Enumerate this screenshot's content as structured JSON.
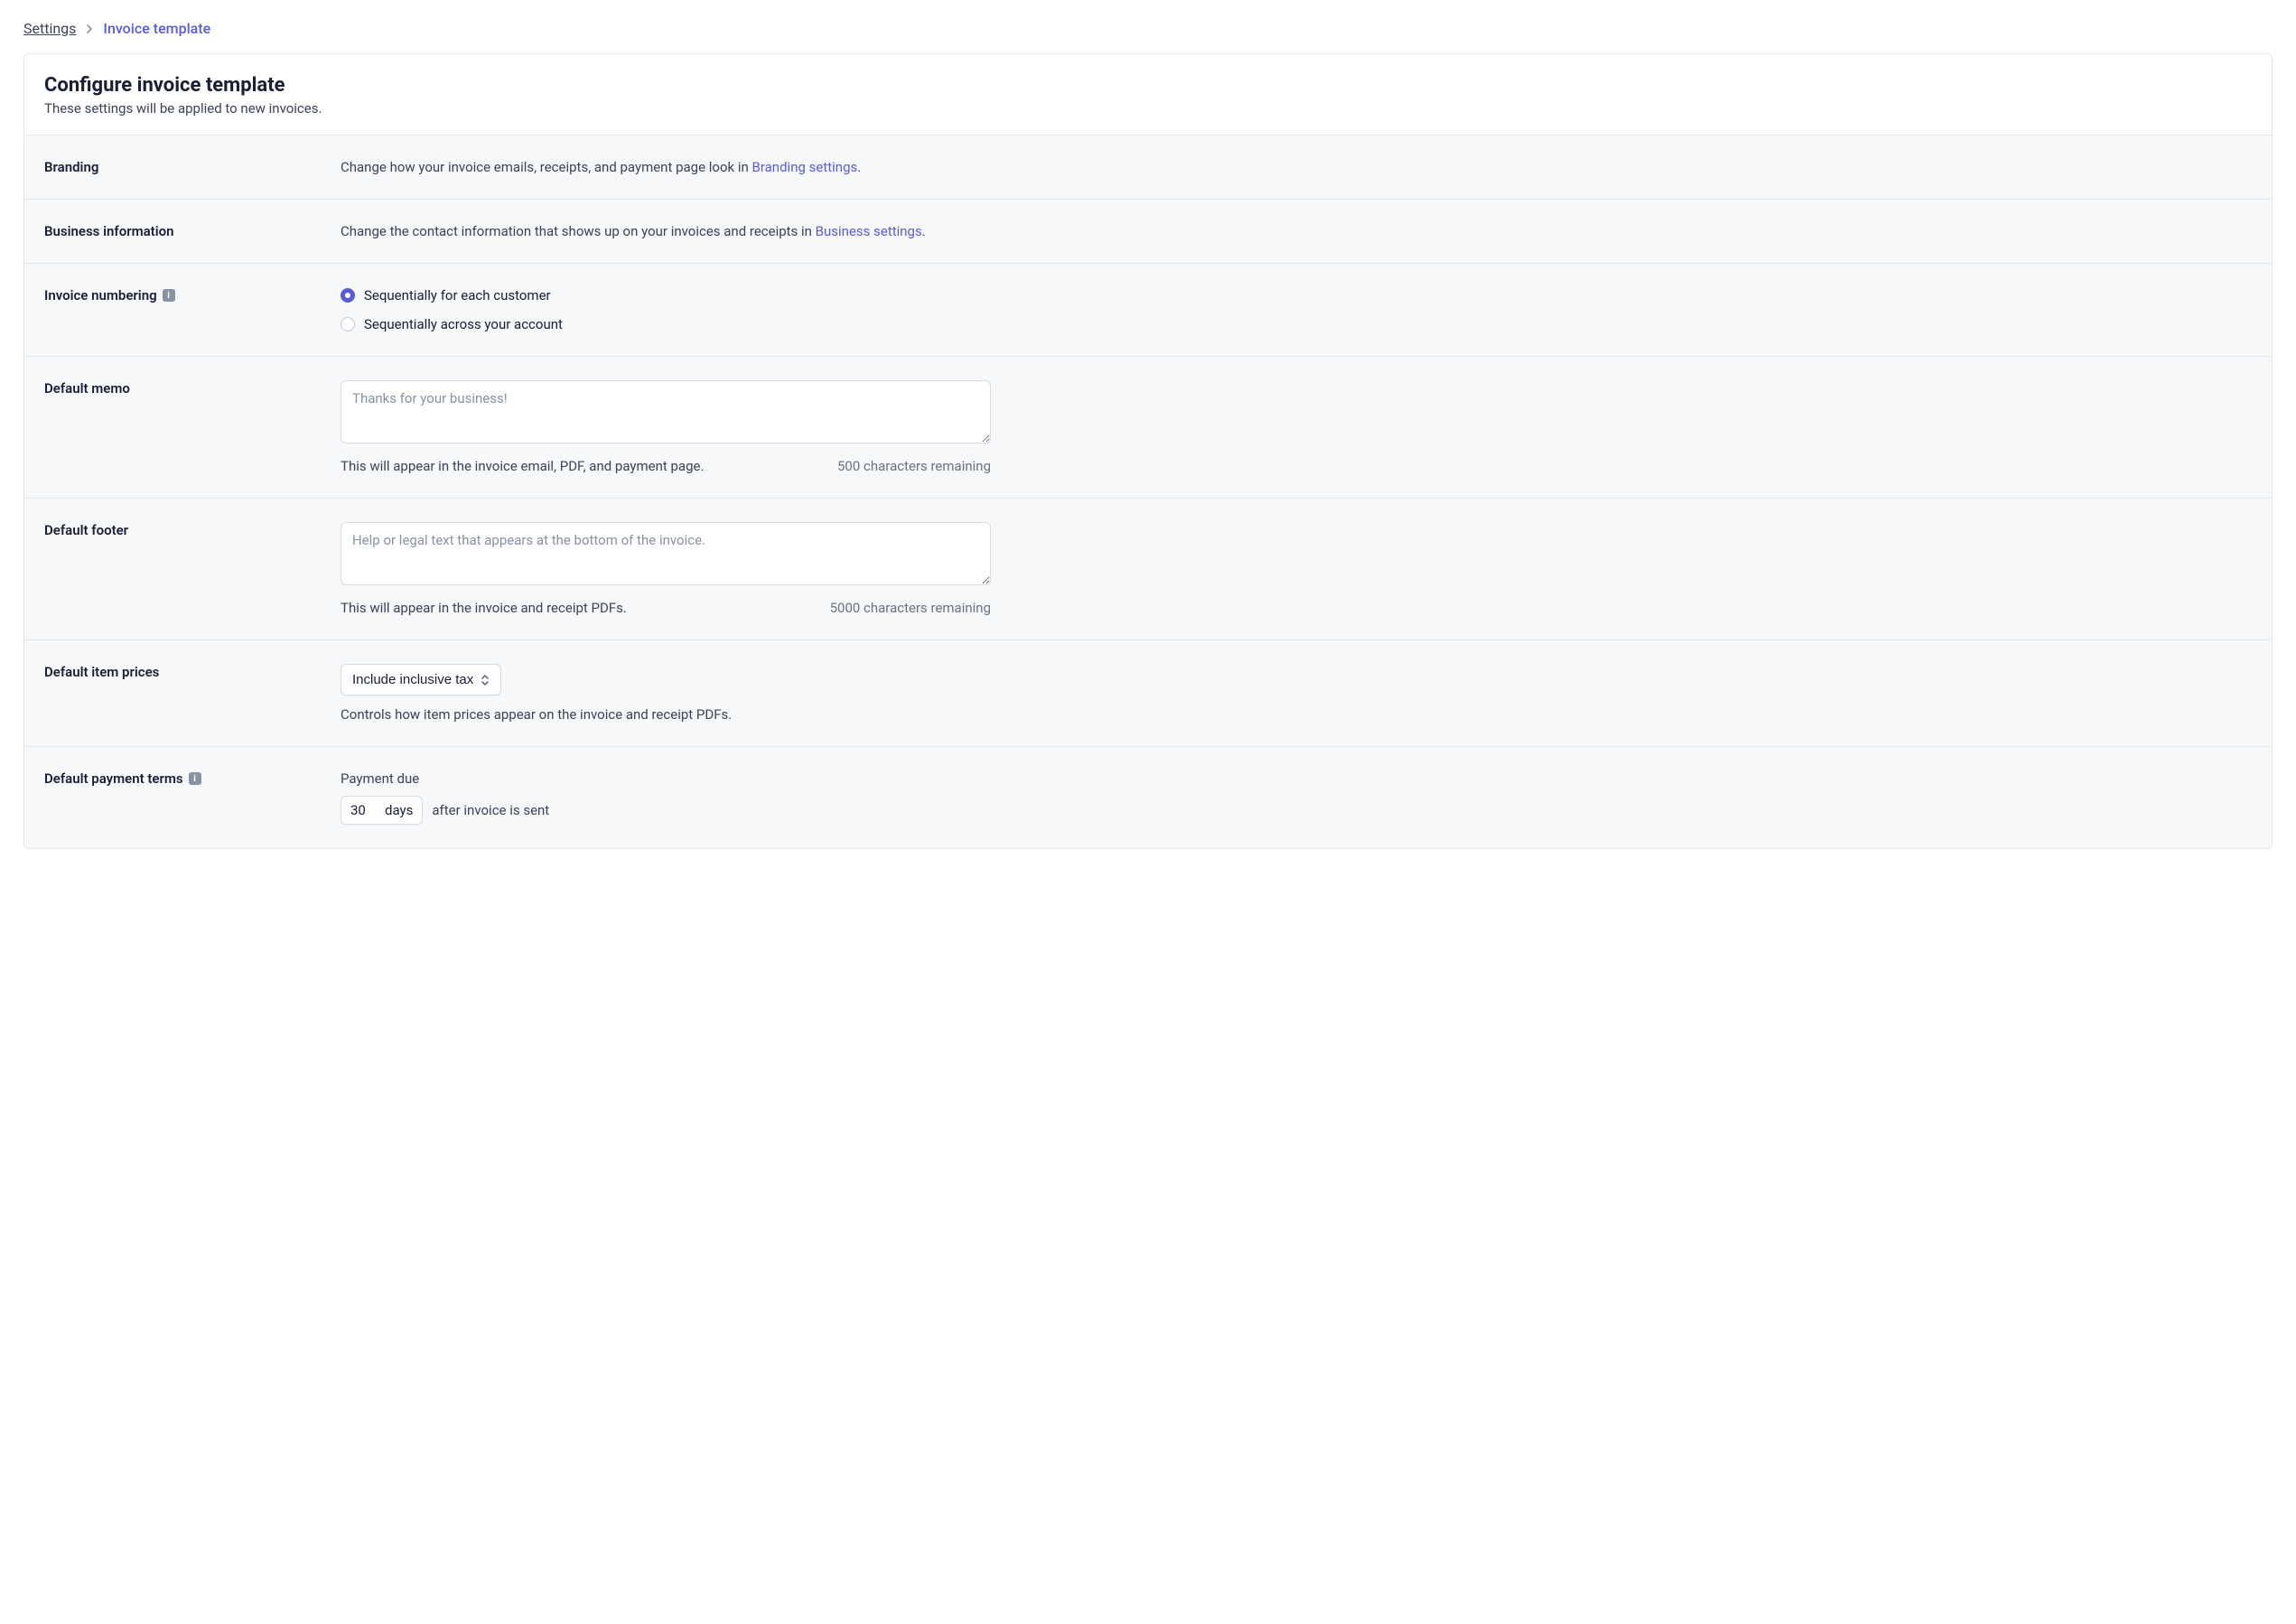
{
  "breadcrumb": {
    "parent": "Settings",
    "current": "Invoice template"
  },
  "header": {
    "title": "Configure invoice template",
    "subtitle": "These settings will be applied to new invoices."
  },
  "branding": {
    "label": "Branding",
    "text_before": "Change how your invoice emails, receipts, and payment page look in ",
    "link": "Branding settings",
    "text_after": "."
  },
  "business": {
    "label": "Business information",
    "text_before": "Change the contact information that shows up on your invoices and receipts in ",
    "link": "Business settings",
    "text_after": "."
  },
  "numbering": {
    "label": "Invoice numbering",
    "option1": "Sequentially for each customer",
    "option2": "Sequentially across your account"
  },
  "memo": {
    "label": "Default memo",
    "placeholder": "Thanks for your business!",
    "helper": "This will appear in the invoice email, PDF, and payment page.",
    "count": "500 characters remaining"
  },
  "footer": {
    "label": "Default footer",
    "placeholder": "Help or legal text that appears at the bottom of the invoice.",
    "helper": "This will appear in the invoice and receipt PDFs.",
    "count": "5000 characters remaining"
  },
  "prices": {
    "label": "Default item prices",
    "selected": "Include inclusive tax",
    "helper": "Controls how item prices appear on the invoice and receipt PDFs."
  },
  "terms": {
    "label": "Default payment terms",
    "payment_due": "Payment due",
    "days_value": "30",
    "days_unit": "days",
    "after": "after invoice is sent"
  }
}
